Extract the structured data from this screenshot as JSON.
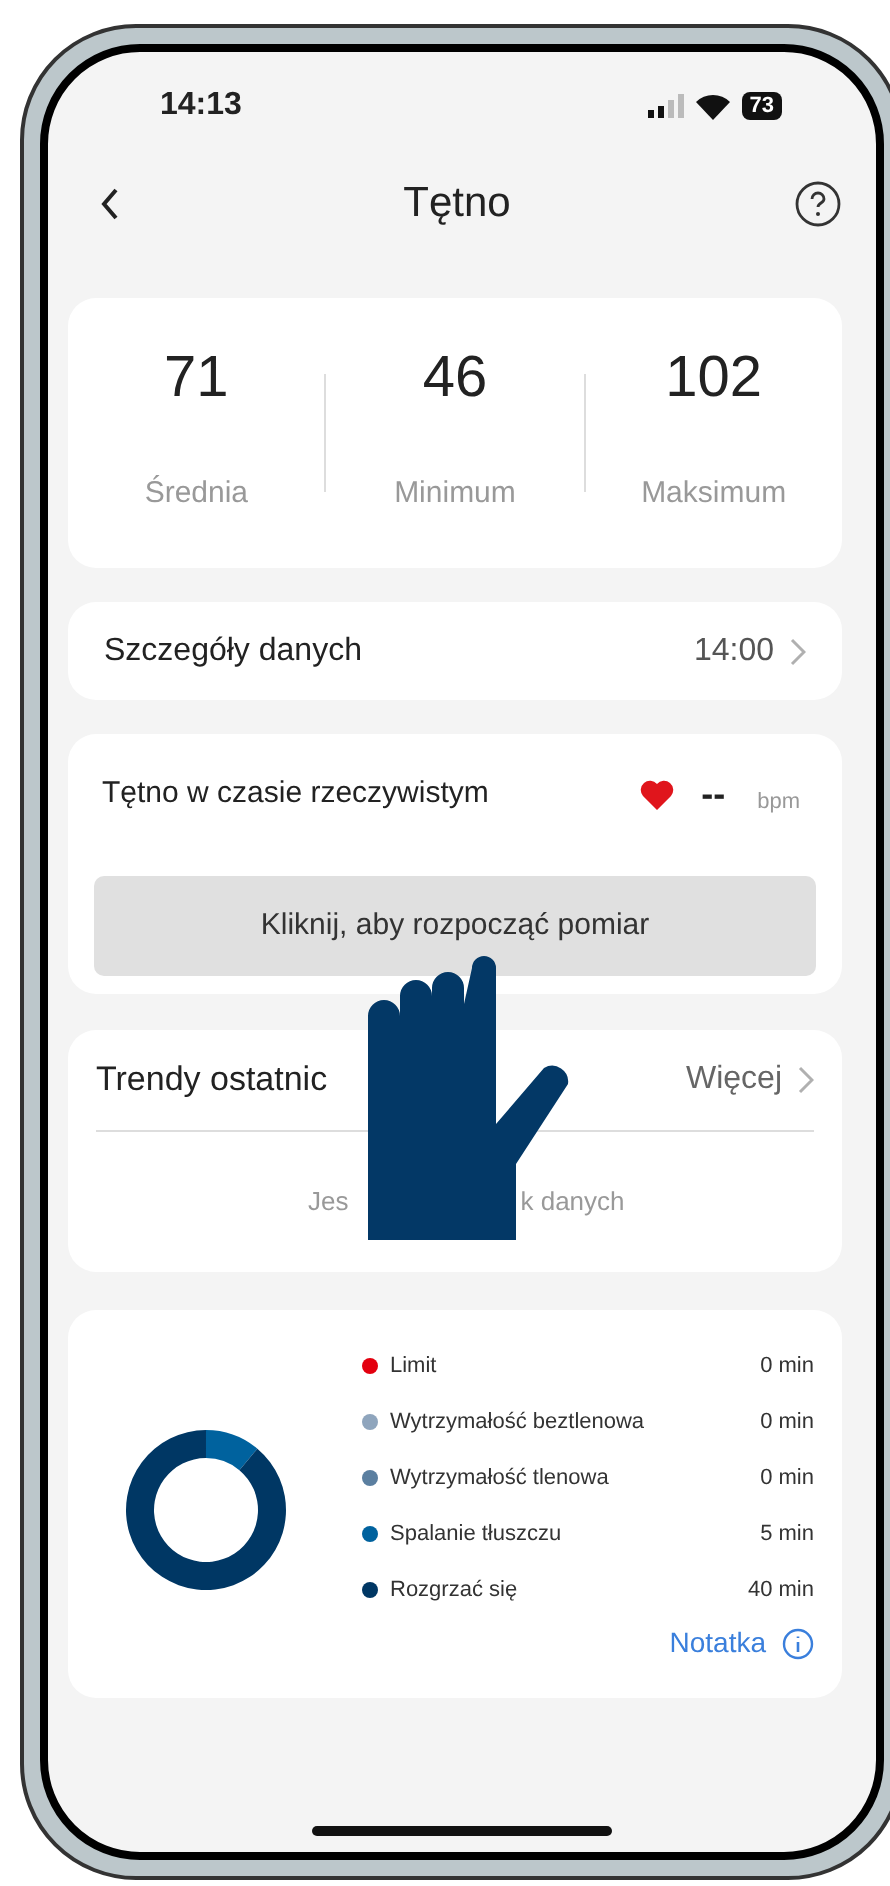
{
  "status_bar": {
    "time": "14:13",
    "battery": "73"
  },
  "header": {
    "title": "Tętno"
  },
  "stats": [
    {
      "value": "71",
      "label": "Średnia"
    },
    {
      "value": "46",
      "label": "Minimum"
    },
    {
      "value": "102",
      "label": "Maksimum"
    }
  ],
  "details": {
    "label": "Szczegóły danych",
    "value": "14:00"
  },
  "realtime": {
    "title": "Tętno w czasie rzeczywistym",
    "reading": "--",
    "unit": "bpm",
    "button": "Kliknij, aby rozpocząć pomiar"
  },
  "trends": {
    "title": "Trendy ostatnic",
    "more": "Więcej",
    "empty_text_start": "Jes",
    "empty_text_end": "k danych"
  },
  "zones": {
    "items": [
      {
        "duration": "0 min",
        "color": "#e3000f"
      },
      {
        "duration": "0 min",
        "color": "#8fa5bd"
      },
      {
        "duration": "0 min",
        "color": "#5b7fa0"
      },
      {
        "duration": "5 min",
        "color": "#00629e"
      },
      {
        "duration": "40 min",
        "color": "#003764"
      }
    ],
    "chart_data": {
      "type": "donut",
      "categories": [
        "Limit",
        "Wytrzymałość beztlenowa",
        "Wytrzymałość tlenowa",
        "Spalanie tłuszczu",
        "Rozgrzać się"
      ],
      "values": [
        0,
        0,
        0,
        11.1,
        88.9
      ]
    },
    "note_link": "Notatka"
  }
}
